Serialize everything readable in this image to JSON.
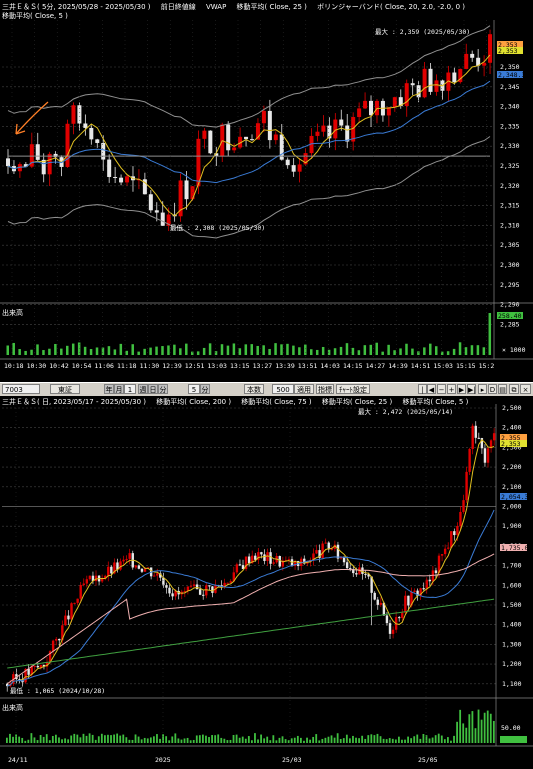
{
  "top": {
    "title_parts": [
      "三井Ｅ＆Ｓ( 5分, 2025/05/28 - 2025/05/30 )",
      "前日終値線",
      "VWAP",
      "移動平均( Close, 25 )",
      "ボリンジャーバンド( Close, 20, 2.0, -2.0, 0 )"
    ],
    "subtitle": "移動平均( Close, 5 )",
    "max_label": "最大 : 2,359 (2025/05/30)",
    "min_label": "最低 : 2,308 (2025/05/30)",
    "price_ticks": [
      "2,350",
      "2,345",
      "2,340",
      "2,335",
      "2,330",
      "2,325",
      "2,320",
      "2,315",
      "2,310",
      "2,305",
      "2,300",
      "2,295",
      "2,290",
      "2,285"
    ],
    "badges": [
      {
        "text": "2,353",
        "color": "#ffa040"
      },
      {
        "text": "2,353",
        "color": "#e0e030"
      },
      {
        "text": "2,348.38",
        "color": "#3a7bd5"
      }
    ],
    "volume_label": "出来高",
    "volume_value": "258.40",
    "volume_unit": "× 1000",
    "time_labels": [
      "10:18",
      "10:30",
      "10:42",
      "10:54",
      "11:06",
      "11:18",
      "11:30",
      "12:39",
      "12:51",
      "13:03",
      "13:15",
      "13:27",
      "13:39",
      "13:51",
      "14:03",
      "14:15",
      "14:27",
      "14:39",
      "14:51",
      "15:03",
      "15:15",
      "15:2"
    ]
  },
  "toolbar": {
    "code": "7003",
    "market": "東証",
    "buttons": [
      "年",
      "月",
      "週",
      "日",
      "分",
      "分"
    ],
    "n1": "1",
    "n2": "5",
    "count_label": "本数",
    "count_value": "500",
    "apply": "適用",
    "indicator": "指標",
    "settings": "ﾁｬｰﾄ設定"
  },
  "bottom": {
    "title_parts": [
      "三井Ｅ＆Ｓ( 日, 2023/05/17 - 2025/05/30 )",
      "移動平均( Close, 200 )",
      "移動平均( Close, 75 )",
      "移動平均( Close, 25 )",
      "移動平均( Close, 5 )"
    ],
    "max_label": "最大 : 2,472 (2025/05/14)",
    "min_label": "最低 : 1,065 (2024/10/28)",
    "price_ticks": [
      "2,500",
      "2,400",
      "2,300",
      "2,200",
      "2,100",
      "2,000",
      "1,900",
      "1,800",
      "1,700",
      "1,600",
      "1,500",
      "1,400",
      "1,300",
      "1,200",
      "1,100"
    ],
    "badges": [
      {
        "text": "2,355",
        "color": "#ffa040"
      },
      {
        "text": "2,353",
        "color": "#e0e030"
      },
      {
        "text": "2,054.38",
        "color": "#3a7bd5"
      },
      {
        "text": "1,735.00",
        "color": "#f0b0b0"
      }
    ],
    "volume_label": "出来高",
    "volume_value": "50.00",
    "time_labels": [
      "24/11",
      "2025",
      "25/03",
      "25/05"
    ]
  },
  "colors": {
    "up": "#e00000",
    "down": "#e8e8e8",
    "ma5": "#e0c020",
    "ma25": "#3a7bd5",
    "ma75": "#f0b0b0",
    "ma200": "#40a040",
    "bb": "#909090",
    "volume": "#40c040"
  }
}
